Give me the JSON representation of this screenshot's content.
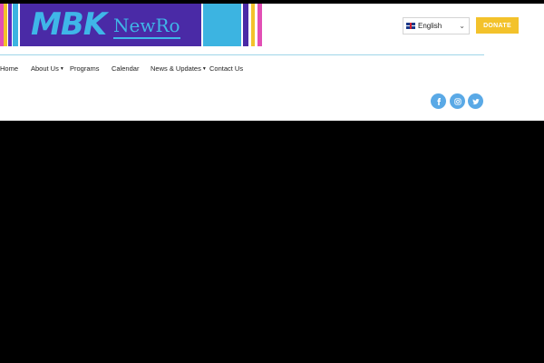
{
  "logo": {
    "mark": "MBK",
    "name": "NewRo"
  },
  "language": {
    "selected": "English"
  },
  "donate_label": "DONATE",
  "nav": [
    {
      "label": "Home"
    },
    {
      "label": "About Us",
      "has_dropdown": true
    },
    {
      "label": "Programs"
    },
    {
      "label": "Calendar"
    },
    {
      "label": "News & Updates",
      "has_dropdown": true
    },
    {
      "label": "Contact Us"
    }
  ],
  "social": [
    "facebook-icon",
    "instagram-icon",
    "twitter-icon"
  ],
  "colors": {
    "brand_purple": "#4a2aa6",
    "brand_blue": "#3fb6e8",
    "donate_yellow": "#f3c22b",
    "social_blue": "#5aa9e6"
  }
}
